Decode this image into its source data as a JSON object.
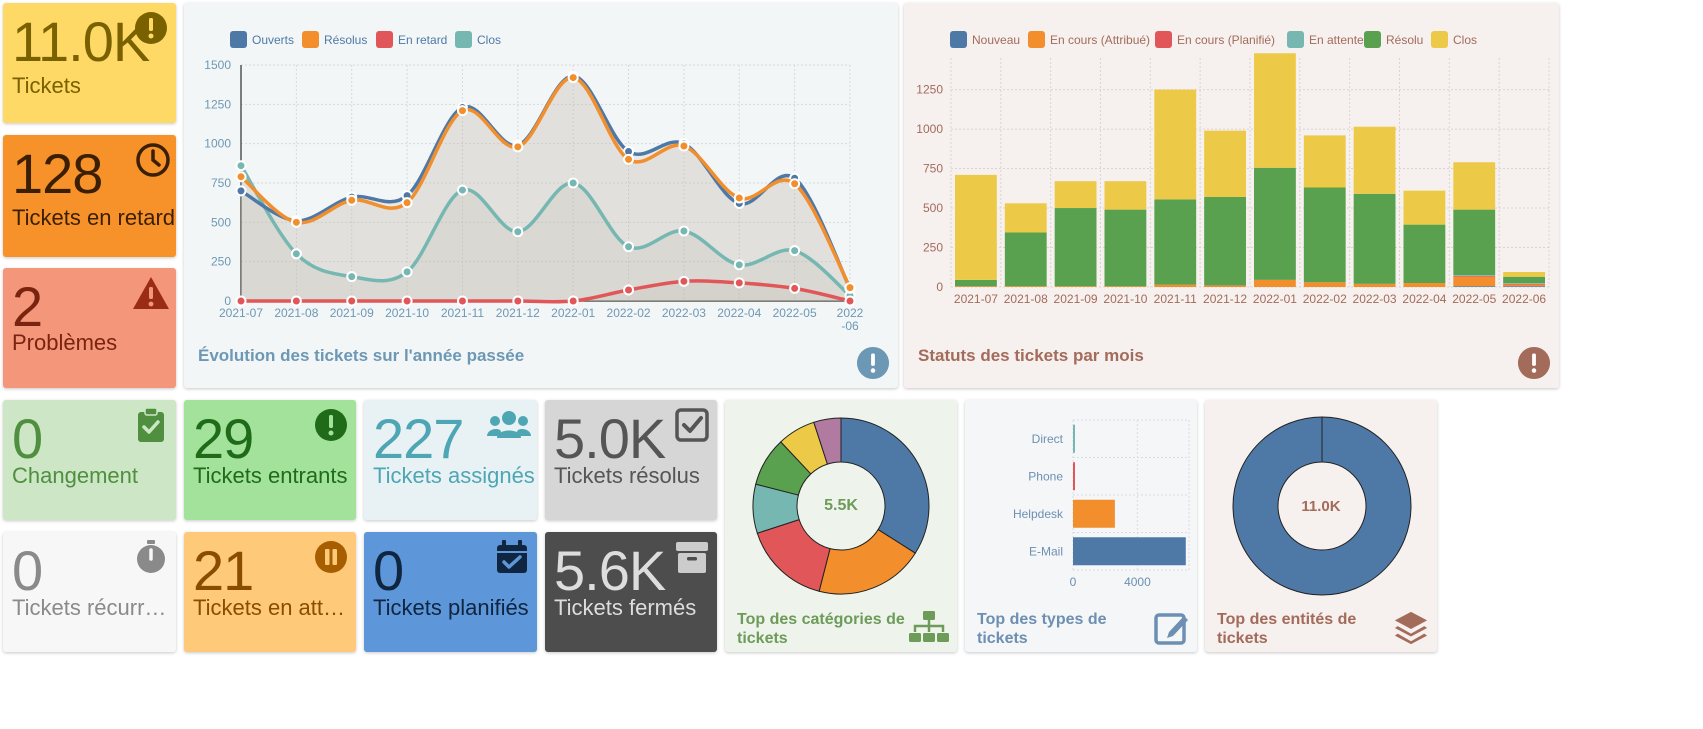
{
  "top_cards": [
    {
      "value": "11.0K",
      "label": "Tickets",
      "icon": "exclamation-circle-icon",
      "bg": "#ffd966",
      "fg": "#7a6100"
    },
    {
      "value": "128",
      "label": "Tickets en retard",
      "icon": "clock-icon",
      "bg": "#f7922b",
      "fg": "#3b1f02"
    },
    {
      "value": "2",
      "label": "Problèmes",
      "icon": "warning-triangle-icon",
      "bg": "#f3967a",
      "fg": "#7a2410"
    }
  ],
  "bottom_cards": [
    {
      "value": "0",
      "label": "Changement",
      "icon": "clipboard-check-icon",
      "bg": "#cde6c6",
      "fg": "#4f8f3f"
    },
    {
      "value": "29",
      "label": "Tickets entrants",
      "icon": "exclamation-circle-icon",
      "bg": "#a2e29a",
      "fg": "#1f6b1a"
    },
    {
      "value": "227",
      "label": "Tickets assignés",
      "icon": "users-icon",
      "bg": "#e8f2f4",
      "fg": "#4ea6b4"
    },
    {
      "value": "5.0K",
      "label": "Tickets résolus",
      "icon": "check-square-icon",
      "bg": "#d6d6d6",
      "fg": "#555555"
    },
    {
      "value": "0",
      "label": "Tickets récurre…",
      "icon": "stopwatch-icon",
      "bg": "#f7f7f7",
      "fg": "#8a8a8a"
    },
    {
      "value": "21",
      "label": "Tickets en atte…",
      "icon": "pause-circle-icon",
      "bg": "#ffc97a",
      "fg": "#8a4d00"
    },
    {
      "value": "0",
      "label": "Tickets planifiés",
      "icon": "calendar-check-icon",
      "bg": "#5d97d9",
      "fg": "#0f2540"
    },
    {
      "value": "5.6K",
      "label": "Tickets fermés",
      "icon": "archive-icon",
      "bg": "#4d4d4d",
      "fg": "#dddddd"
    }
  ],
  "line_chart": {
    "title": "Évolution des tickets sur l'année passée",
    "y_ticks": [
      "0",
      "250",
      "500",
      "750",
      "1000",
      "1250",
      "1500"
    ],
    "x_ticks": [
      "2021-07",
      "2021-08",
      "2021-09",
      "2021-10",
      "2021-11",
      "2021-12",
      "2022-01",
      "2022-02",
      "2022-03",
      "2022-04",
      "2022-05",
      "2022\n-06"
    ]
  },
  "bar_chart": {
    "title": "Statuts des tickets par mois",
    "y_ticks": [
      "0",
      "250",
      "500",
      "750",
      "1000",
      "1250"
    ],
    "x_ticks": [
      "2021-07",
      "2021-08",
      "2021-09",
      "2021-10",
      "2021-11",
      "2021-12",
      "2022-01",
      "2022-02",
      "2022-03",
      "2022-04",
      "2022-05",
      "2022-06"
    ]
  },
  "donut_categories": {
    "center": "5.5K",
    "title": "Top des catégories de tickets"
  },
  "types_chart": {
    "title": "Top des types de tickets",
    "x_ticks": [
      "0",
      "4000"
    ]
  },
  "donut_entities": {
    "center": "11.0K",
    "title": "Top des entités de tickets"
  },
  "chart_data": [
    {
      "type": "area",
      "ylim": [
        0,
        1500
      ],
      "x": [
        "2021-07",
        "2021-08",
        "2021-09",
        "2021-10",
        "2021-11",
        "2021-12",
        "2022-01",
        "2022-02",
        "2022-03",
        "2022-04",
        "2022-05",
        "2022-06"
      ],
      "series": [
        {
          "name": "Ouverts",
          "color": "#4e79a7",
          "values": [
            700,
            510,
            660,
            670,
            1230,
            990,
            1430,
            950,
            1000,
            620,
            780,
            80
          ]
        },
        {
          "name": "Résolus",
          "color": "#f28e2b",
          "values": [
            790,
            500,
            640,
            625,
            1210,
            980,
            1420,
            900,
            985,
            655,
            745,
            85
          ]
        },
        {
          "name": "En retard",
          "color": "#e15759",
          "values": [
            0,
            0,
            0,
            0,
            0,
            0,
            0,
            70,
            125,
            115,
            80,
            0
          ]
        },
        {
          "name": "Clos",
          "color": "#76b7b2",
          "values": [
            860,
            300,
            155,
            185,
            705,
            440,
            750,
            345,
            445,
            230,
            320,
            35
          ]
        }
      ]
    },
    {
      "type": "bar",
      "stacked": true,
      "ylim": [
        0,
        1450
      ],
      "categories": [
        "2021-07",
        "2021-08",
        "2021-09",
        "2021-10",
        "2021-11",
        "2021-12",
        "2022-01",
        "2022-02",
        "2022-03",
        "2022-04",
        "2022-05",
        "2022-06"
      ],
      "series": [
        {
          "name": "Nouveau",
          "color": "#4e79a7",
          "values": [
            0,
            0,
            0,
            0,
            0,
            0,
            0,
            0,
            0,
            0,
            5,
            5
          ]
        },
        {
          "name": "En cours (Attribué)",
          "color": "#f28e2b",
          "values": [
            5,
            5,
            5,
            5,
            15,
            10,
            45,
            30,
            20,
            25,
            60,
            10
          ]
        },
        {
          "name": "En cours (Planifié)",
          "color": "#e15759",
          "values": [
            0,
            0,
            0,
            0,
            0,
            0,
            0,
            0,
            0,
            0,
            5,
            5
          ]
        },
        {
          "name": "En attente",
          "color": "#76b7b2",
          "values": [
            0,
            0,
            0,
            0,
            0,
            0,
            0,
            0,
            0,
            0,
            5,
            5
          ]
        },
        {
          "name": "Résolu",
          "color": "#59a14f",
          "values": [
            40,
            340,
            495,
            485,
            540,
            560,
            710,
            600,
            570,
            370,
            415,
            40
          ]
        },
        {
          "name": "Clos",
          "color": "#edc948",
          "values": [
            665,
            185,
            170,
            180,
            695,
            420,
            725,
            330,
            425,
            215,
            300,
            30
          ]
        }
      ]
    },
    {
      "type": "pie",
      "donut": true,
      "values": [
        34,
        20,
        16,
        9,
        9,
        7,
        5
      ],
      "colors": [
        "#4e79a7",
        "#f28e2b",
        "#e15759",
        "#76b7b2",
        "#59a14f",
        "#edc948",
        "#b07aa1"
      ]
    },
    {
      "type": "bar",
      "orientation": "horizontal",
      "categories": [
        "Direct",
        "Phone",
        "Helpdesk",
        "E-Mail"
      ],
      "values": [
        5,
        80,
        2600,
        7000
      ],
      "colors": [
        "#76b7b2",
        "#e15759",
        "#f28e2b",
        "#4e79a7"
      ],
      "xlim": [
        0,
        7200
      ]
    },
    {
      "type": "pie",
      "donut": true,
      "values": [
        100
      ],
      "colors": [
        "#4e79a7"
      ]
    }
  ]
}
